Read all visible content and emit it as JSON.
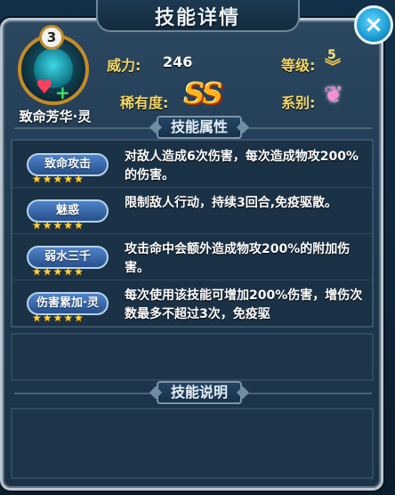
{
  "title": "技能详情",
  "close_icon": "×",
  "skill": {
    "level": "3",
    "name": "致命芳华·灵"
  },
  "stats": {
    "power_label": "威力:",
    "power_value": "246",
    "grade_label": "等级:",
    "grade_value": "5",
    "rarity_label": "稀有度:",
    "rarity_value": "SS",
    "type_label": "系别:"
  },
  "sections": {
    "attributes": "技能属性",
    "explanation": "技能说明"
  },
  "attributes": [
    {
      "tag": "致命攻击",
      "stars": "★★★★★",
      "desc": "对敌人造成6次伤害，每次造成物攻200%的伤害。"
    },
    {
      "tag": "魅惑",
      "stars": "★★★★★",
      "desc": "限制敌人行动，持续3回合,免疫驱散。"
    },
    {
      "tag": "弱水三千",
      "stars": "★★★★★",
      "desc": "攻击命中会额外造成物攻200%的附加伤害。"
    },
    {
      "tag": "伤害累加·灵",
      "stars": "★★★★★",
      "desc": "每次使用该技能可增加200%伤害，增伤次数最多不超过3次，免疫驱"
    }
  ],
  "colors": {
    "accent_gold": "#f3d76a",
    "tag_blue": "#3b6db0",
    "star": "#ffd33c",
    "ss": "#ffb51b"
  },
  "icons": {
    "close": "close-icon",
    "grade": "grade-chevron-icon",
    "type": "butterfly-icon",
    "skill": "skill-portrait-icon"
  }
}
